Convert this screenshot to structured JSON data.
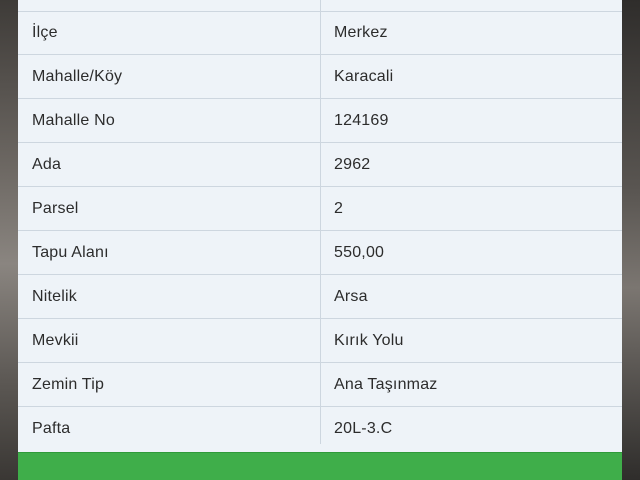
{
  "rows": [
    {
      "label": "İlçe",
      "value": "Merkez"
    },
    {
      "label": "Mahalle/Köy",
      "value": "Karacali"
    },
    {
      "label": "Mahalle No",
      "value": "124169"
    },
    {
      "label": "Ada",
      "value": "2962"
    },
    {
      "label": "Parsel",
      "value": "2"
    },
    {
      "label": "Tapu Alanı",
      "value": "550,00"
    },
    {
      "label": "Nitelik",
      "value": "Arsa"
    },
    {
      "label": "Mevkii",
      "value": "Kırık Yolu"
    },
    {
      "label": "Zemin Tip",
      "value": "Ana Taşınmaz"
    },
    {
      "label": "Pafta",
      "value": "20L-3.C"
    }
  ],
  "colors": {
    "card_background": "#eef3f8",
    "row_border": "#cdd6df",
    "text": "#2c2c2c",
    "button": "#3fae4a"
  }
}
